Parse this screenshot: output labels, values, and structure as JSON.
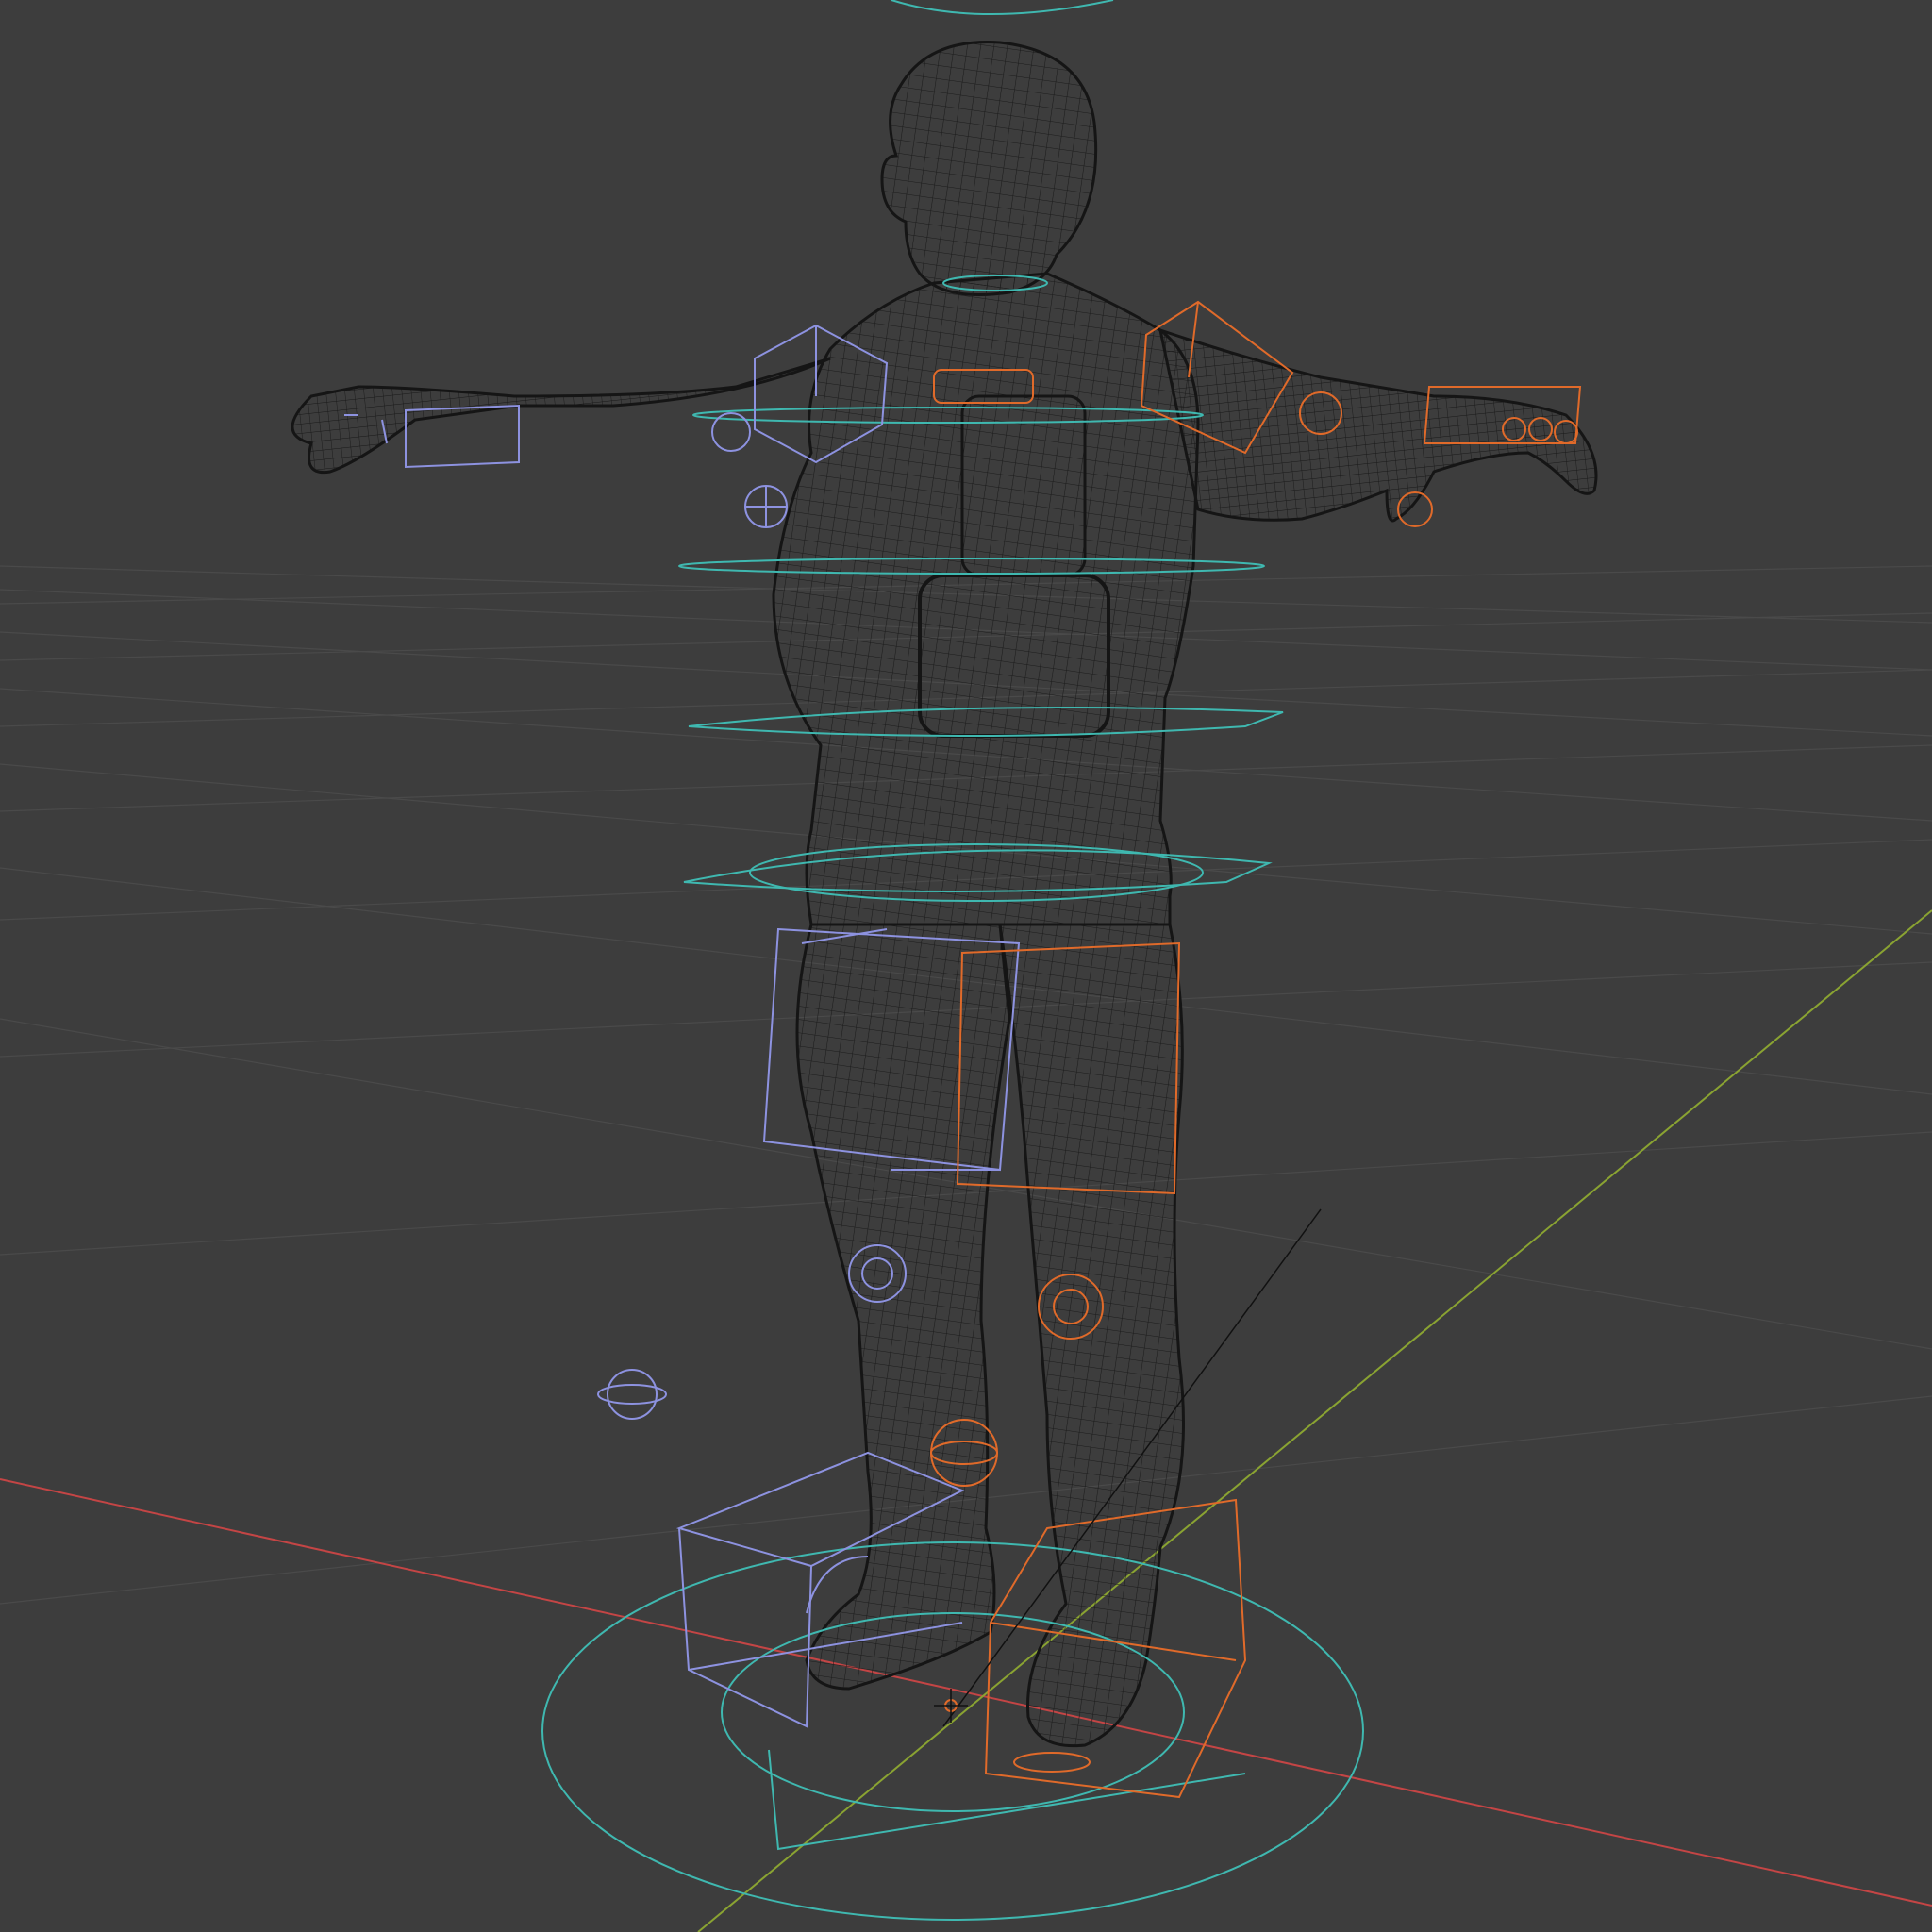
{
  "viewport": {
    "background": "#3d3d3d",
    "grid_color": "#4a4a4a",
    "mode": "wireframe"
  },
  "axes": {
    "x_axis_color": "#c44545",
    "y_axis_color": "#8aa332"
  },
  "rig": {
    "left_side_color": "#8d92e0",
    "right_side_color": "#e06a2a",
    "center_color": "#3fb8b0",
    "mesh_color": "#141414"
  },
  "icons": {
    "origin": "3d-cursor-icon"
  }
}
